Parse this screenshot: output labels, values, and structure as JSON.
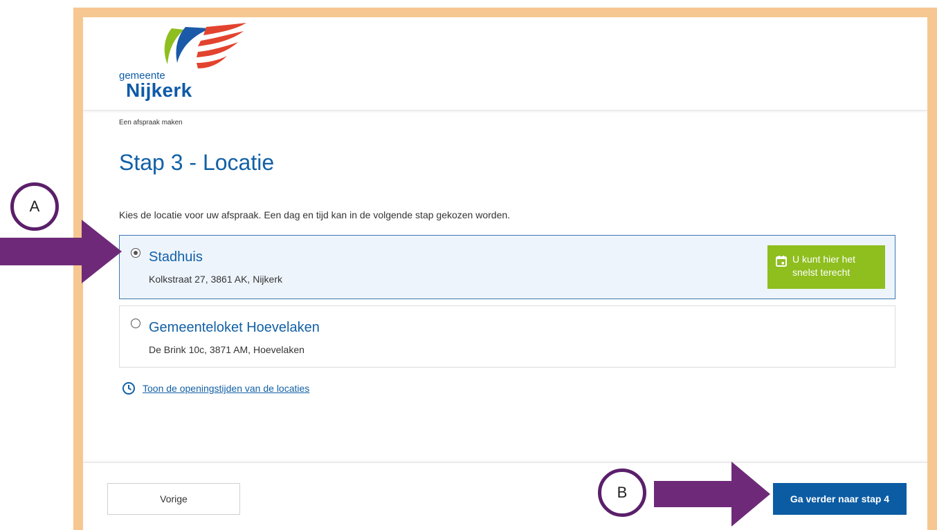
{
  "logo": {
    "line1": "gemeente",
    "line2": "Nijkerk"
  },
  "breadcrumb": "Een afspraak maken",
  "page_title": "Stap 3 - Locatie",
  "intro": "Kies de locatie voor uw afspraak. Een dag en tijd kan in de volgende stap gekozen worden.",
  "locations": [
    {
      "name": "Stadhuis",
      "address": "Kolkstraat 27, 3861 AK, Nijkerk",
      "selected": true,
      "badge": {
        "icon": "calendar-icon",
        "line1": "U kunt hier het",
        "line2": "snelst terecht"
      }
    },
    {
      "name": "Gemeenteloket Hoevelaken",
      "address": "De Brink 10c, 3871 AM, Hoevelaken",
      "selected": false
    }
  ],
  "hours_link": {
    "icon": "clock-icon",
    "label": "Toon de openingstijden van de locaties"
  },
  "footer": {
    "prev_label": "Vorige",
    "next_label": "Ga verder naar stap 4"
  },
  "annotations": {
    "marker_a": "A",
    "marker_b": "B"
  },
  "colors": {
    "frame": "#f6c791",
    "primary_blue": "#0c5ca3",
    "badge_green": "#8fbe1f",
    "arrow_purple": "#6e2a78",
    "selected_bg": "#edf4fb"
  }
}
